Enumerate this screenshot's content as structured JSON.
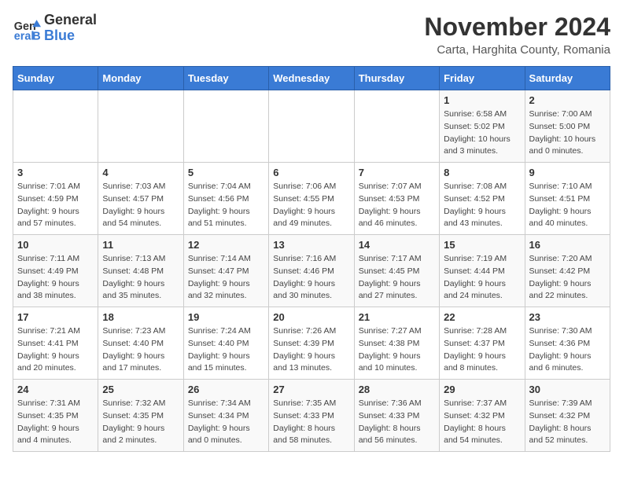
{
  "header": {
    "logo_general": "General",
    "logo_blue": "Blue",
    "title": "November 2024",
    "subtitle": "Carta, Harghita County, Romania"
  },
  "weekdays": [
    "Sunday",
    "Monday",
    "Tuesday",
    "Wednesday",
    "Thursday",
    "Friday",
    "Saturday"
  ],
  "weeks": [
    [
      {
        "day": "",
        "sunrise": "",
        "sunset": "",
        "daylight": ""
      },
      {
        "day": "",
        "sunrise": "",
        "sunset": "",
        "daylight": ""
      },
      {
        "day": "",
        "sunrise": "",
        "sunset": "",
        "daylight": ""
      },
      {
        "day": "",
        "sunrise": "",
        "sunset": "",
        "daylight": ""
      },
      {
        "day": "",
        "sunrise": "",
        "sunset": "",
        "daylight": ""
      },
      {
        "day": "1",
        "sunrise": "Sunrise: 6:58 AM",
        "sunset": "Sunset: 5:02 PM",
        "daylight": "Daylight: 10 hours and 3 minutes."
      },
      {
        "day": "2",
        "sunrise": "Sunrise: 7:00 AM",
        "sunset": "Sunset: 5:00 PM",
        "daylight": "Daylight: 10 hours and 0 minutes."
      }
    ],
    [
      {
        "day": "3",
        "sunrise": "Sunrise: 7:01 AM",
        "sunset": "Sunset: 4:59 PM",
        "daylight": "Daylight: 9 hours and 57 minutes."
      },
      {
        "day": "4",
        "sunrise": "Sunrise: 7:03 AM",
        "sunset": "Sunset: 4:57 PM",
        "daylight": "Daylight: 9 hours and 54 minutes."
      },
      {
        "day": "5",
        "sunrise": "Sunrise: 7:04 AM",
        "sunset": "Sunset: 4:56 PM",
        "daylight": "Daylight: 9 hours and 51 minutes."
      },
      {
        "day": "6",
        "sunrise": "Sunrise: 7:06 AM",
        "sunset": "Sunset: 4:55 PM",
        "daylight": "Daylight: 9 hours and 49 minutes."
      },
      {
        "day": "7",
        "sunrise": "Sunrise: 7:07 AM",
        "sunset": "Sunset: 4:53 PM",
        "daylight": "Daylight: 9 hours and 46 minutes."
      },
      {
        "day": "8",
        "sunrise": "Sunrise: 7:08 AM",
        "sunset": "Sunset: 4:52 PM",
        "daylight": "Daylight: 9 hours and 43 minutes."
      },
      {
        "day": "9",
        "sunrise": "Sunrise: 7:10 AM",
        "sunset": "Sunset: 4:51 PM",
        "daylight": "Daylight: 9 hours and 40 minutes."
      }
    ],
    [
      {
        "day": "10",
        "sunrise": "Sunrise: 7:11 AM",
        "sunset": "Sunset: 4:49 PM",
        "daylight": "Daylight: 9 hours and 38 minutes."
      },
      {
        "day": "11",
        "sunrise": "Sunrise: 7:13 AM",
        "sunset": "Sunset: 4:48 PM",
        "daylight": "Daylight: 9 hours and 35 minutes."
      },
      {
        "day": "12",
        "sunrise": "Sunrise: 7:14 AM",
        "sunset": "Sunset: 4:47 PM",
        "daylight": "Daylight: 9 hours and 32 minutes."
      },
      {
        "day": "13",
        "sunrise": "Sunrise: 7:16 AM",
        "sunset": "Sunset: 4:46 PM",
        "daylight": "Daylight: 9 hours and 30 minutes."
      },
      {
        "day": "14",
        "sunrise": "Sunrise: 7:17 AM",
        "sunset": "Sunset: 4:45 PM",
        "daylight": "Daylight: 9 hours and 27 minutes."
      },
      {
        "day": "15",
        "sunrise": "Sunrise: 7:19 AM",
        "sunset": "Sunset: 4:44 PM",
        "daylight": "Daylight: 9 hours and 24 minutes."
      },
      {
        "day": "16",
        "sunrise": "Sunrise: 7:20 AM",
        "sunset": "Sunset: 4:42 PM",
        "daylight": "Daylight: 9 hours and 22 minutes."
      }
    ],
    [
      {
        "day": "17",
        "sunrise": "Sunrise: 7:21 AM",
        "sunset": "Sunset: 4:41 PM",
        "daylight": "Daylight: 9 hours and 20 minutes."
      },
      {
        "day": "18",
        "sunrise": "Sunrise: 7:23 AM",
        "sunset": "Sunset: 4:40 PM",
        "daylight": "Daylight: 9 hours and 17 minutes."
      },
      {
        "day": "19",
        "sunrise": "Sunrise: 7:24 AM",
        "sunset": "Sunset: 4:40 PM",
        "daylight": "Daylight: 9 hours and 15 minutes."
      },
      {
        "day": "20",
        "sunrise": "Sunrise: 7:26 AM",
        "sunset": "Sunset: 4:39 PM",
        "daylight": "Daylight: 9 hours and 13 minutes."
      },
      {
        "day": "21",
        "sunrise": "Sunrise: 7:27 AM",
        "sunset": "Sunset: 4:38 PM",
        "daylight": "Daylight: 9 hours and 10 minutes."
      },
      {
        "day": "22",
        "sunrise": "Sunrise: 7:28 AM",
        "sunset": "Sunset: 4:37 PM",
        "daylight": "Daylight: 9 hours and 8 minutes."
      },
      {
        "day": "23",
        "sunrise": "Sunrise: 7:30 AM",
        "sunset": "Sunset: 4:36 PM",
        "daylight": "Daylight: 9 hours and 6 minutes."
      }
    ],
    [
      {
        "day": "24",
        "sunrise": "Sunrise: 7:31 AM",
        "sunset": "Sunset: 4:35 PM",
        "daylight": "Daylight: 9 hours and 4 minutes."
      },
      {
        "day": "25",
        "sunrise": "Sunrise: 7:32 AM",
        "sunset": "Sunset: 4:35 PM",
        "daylight": "Daylight: 9 hours and 2 minutes."
      },
      {
        "day": "26",
        "sunrise": "Sunrise: 7:34 AM",
        "sunset": "Sunset: 4:34 PM",
        "daylight": "Daylight: 9 hours and 0 minutes."
      },
      {
        "day": "27",
        "sunrise": "Sunrise: 7:35 AM",
        "sunset": "Sunset: 4:33 PM",
        "daylight": "Daylight: 8 hours and 58 minutes."
      },
      {
        "day": "28",
        "sunrise": "Sunrise: 7:36 AM",
        "sunset": "Sunset: 4:33 PM",
        "daylight": "Daylight: 8 hours and 56 minutes."
      },
      {
        "day": "29",
        "sunrise": "Sunrise: 7:37 AM",
        "sunset": "Sunset: 4:32 PM",
        "daylight": "Daylight: 8 hours and 54 minutes."
      },
      {
        "day": "30",
        "sunrise": "Sunrise: 7:39 AM",
        "sunset": "Sunset: 4:32 PM",
        "daylight": "Daylight: 8 hours and 52 minutes."
      }
    ]
  ]
}
